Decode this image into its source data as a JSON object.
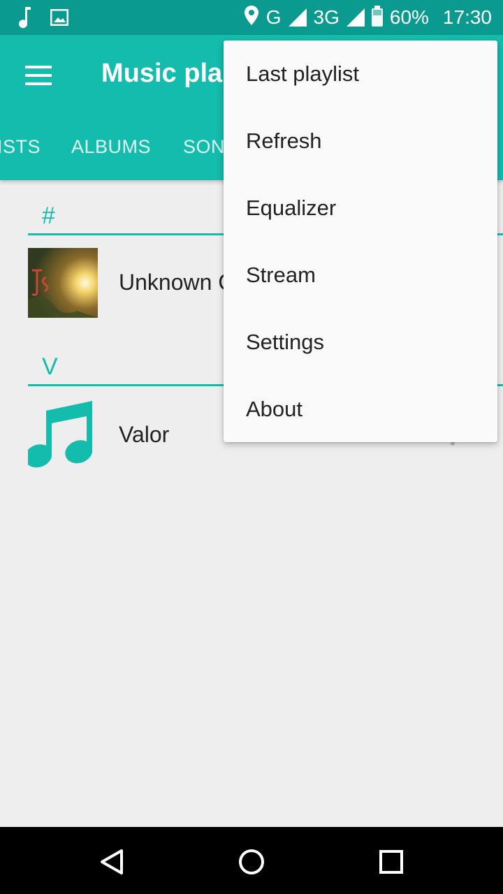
{
  "status_bar": {
    "network_1": "G",
    "network_2": "3G",
    "battery": "60%",
    "time": "17:30",
    "icons": [
      "music-note-icon",
      "image-icon",
      "location-icon",
      "signal-icon",
      "battery-icon"
    ]
  },
  "app_bar": {
    "title": "Music pla",
    "tabs": [
      "ISTS",
      "ALBUMS",
      "SON"
    ],
    "color": "#14bcae"
  },
  "sections": [
    {
      "header": "#",
      "item": "Unknown C"
    },
    {
      "header": "V",
      "item": "Valor"
    }
  ],
  "overflow_menu": {
    "items": [
      "Last playlist",
      "Refresh",
      "Equalizer",
      "Stream",
      "Settings",
      "About"
    ]
  },
  "colors": {
    "accent": "#14bcae",
    "status_bar": "#0b9a8f",
    "background": "#eeeeee"
  }
}
